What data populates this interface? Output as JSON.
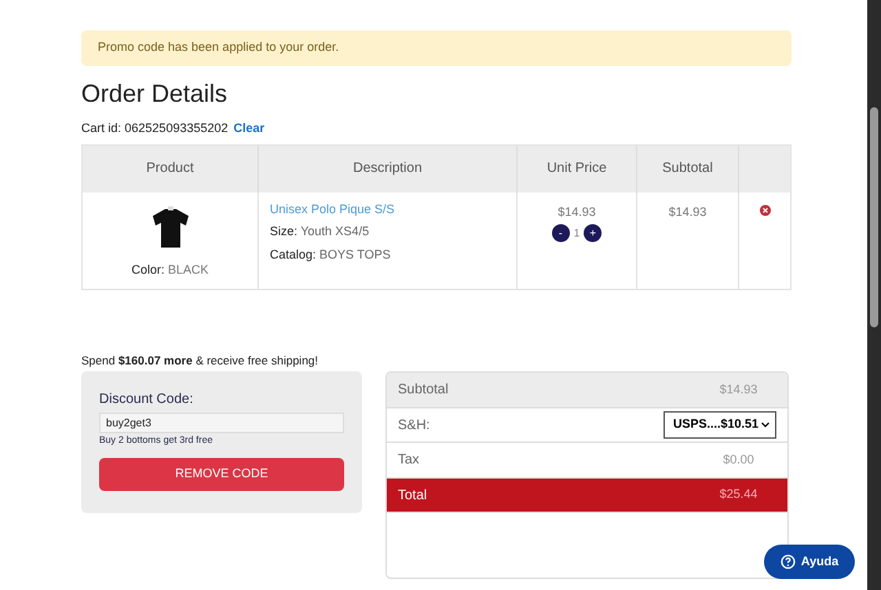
{
  "alert": {
    "message": "Promo code has been applied to your order."
  },
  "title": "Order Details",
  "cart": {
    "label": "Cart id:",
    "id": "062525093355202",
    "clear": "Clear"
  },
  "table": {
    "columns": [
      "Product",
      "Description",
      "Unit Price",
      "Subtotal"
    ],
    "rows": [
      {
        "color_label": "Color:",
        "color_value": "BLACK",
        "name": "Unisex Polo Pique S/S",
        "size_label": "Size:",
        "size": "Youth XS4/5",
        "catalog_label": "Catalog:",
        "catalog": "BOYS TOPS",
        "unit_price": "$14.93",
        "minus": "-",
        "quantity": "1",
        "plus": "+",
        "subtotal": "$14.93"
      }
    ]
  },
  "shipping_note": "Spend **$160.07 more** & receive free shipping!",
  "discount": {
    "label": "Discount Code:",
    "value": "buy2get3",
    "description": "Buy 2 bottoms get 3rd free",
    "button": "REMOVE CODE"
  },
  "summary": [
    {
      "kind": "gray",
      "label": "Subtotal",
      "value": "$14.93"
    },
    {
      "kind": "select",
      "label": "S&H:",
      "value": "USPS....$10.51"
    },
    {
      "kind": "plain",
      "label": "Tax",
      "value": "$0.00"
    },
    {
      "kind": "total",
      "label": "Total",
      "value": "$25.44"
    }
  ],
  "help": {
    "label": "Ayuda"
  }
}
